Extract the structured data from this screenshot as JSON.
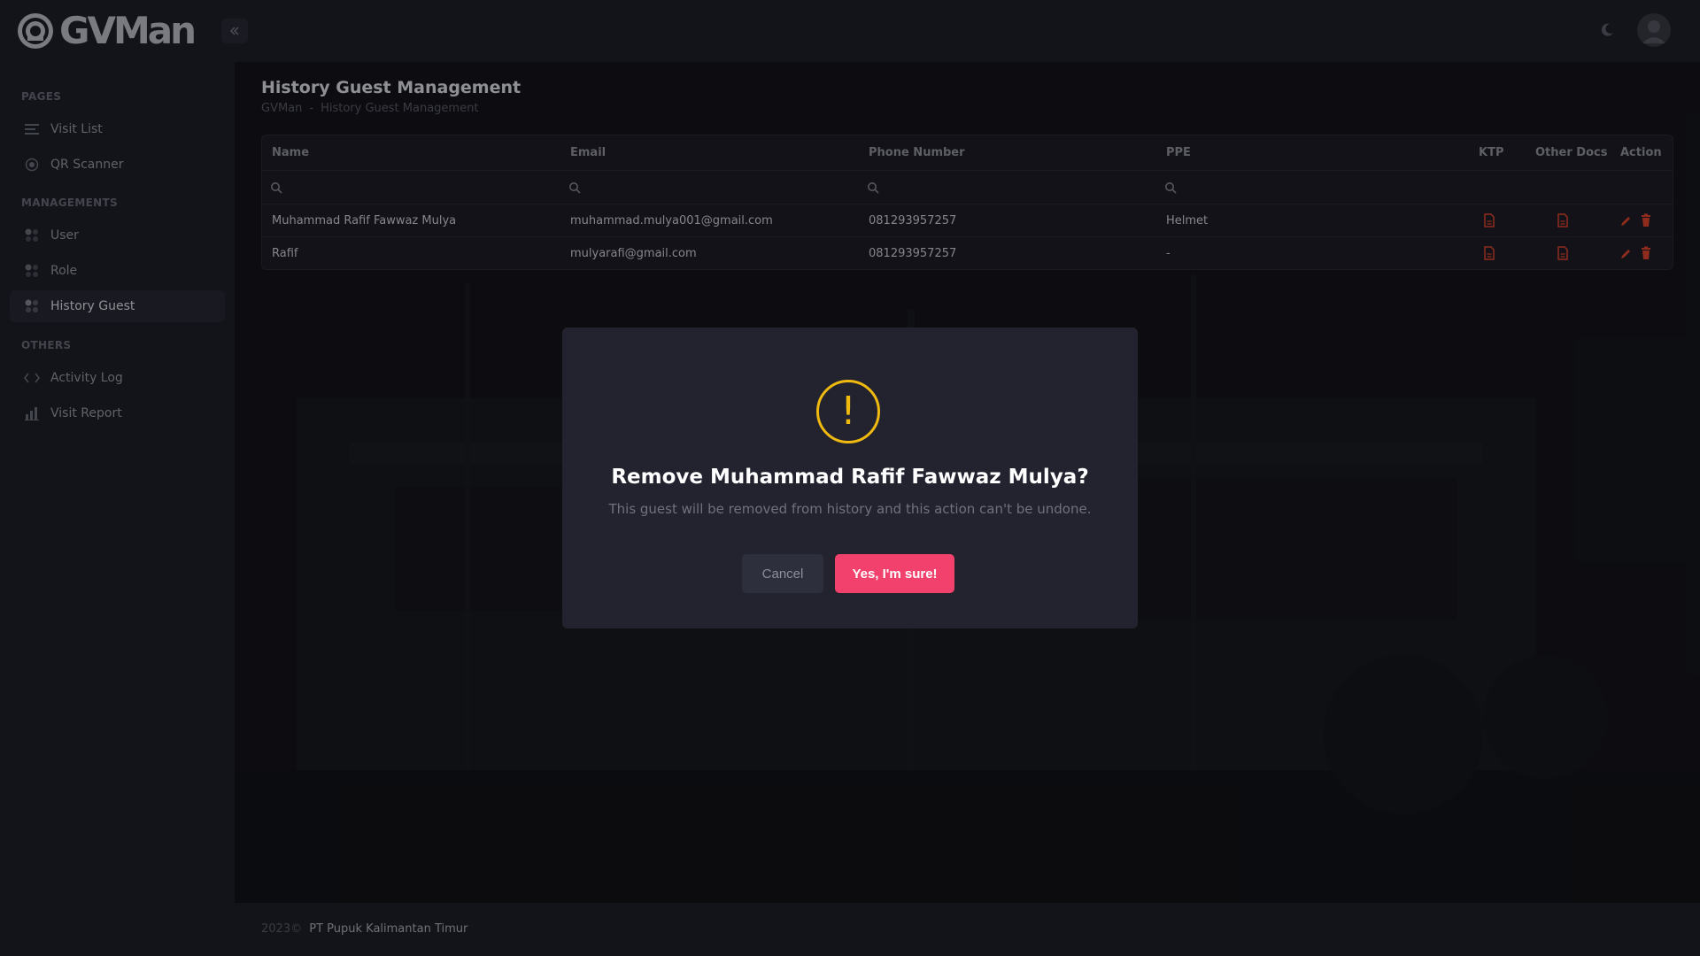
{
  "app": {
    "name": "GVMan"
  },
  "header": {
    "icons": [
      "collapse-icon",
      "moon-icon",
      "avatar-icon"
    ]
  },
  "sidebar": {
    "sections": [
      {
        "label": "PAGES",
        "items": [
          {
            "label": "Visit List",
            "icon": "list-icon"
          },
          {
            "label": "QR Scanner",
            "icon": "target-icon"
          }
        ]
      },
      {
        "label": "MANAGEMENTS",
        "items": [
          {
            "label": "User",
            "icon": "grid-icon"
          },
          {
            "label": "Role",
            "icon": "grid-icon"
          },
          {
            "label": "History Guest",
            "icon": "grid-icon",
            "active": true
          }
        ]
      },
      {
        "label": "OTHERS",
        "items": [
          {
            "label": "Activity Log",
            "icon": "code-icon"
          },
          {
            "label": "Visit Report",
            "icon": "bar-chart-icon"
          }
        ]
      }
    ]
  },
  "page": {
    "title": "History Guest Management",
    "breadcrumb": [
      "GVMan",
      "-",
      "History Guest Management"
    ]
  },
  "table": {
    "columns": [
      "Name",
      "Email",
      "Phone Number",
      "PPE",
      "KTP",
      "Other Docs",
      "Action"
    ],
    "rows": [
      {
        "name": "Muhammad Rafif Fawwaz Mulya",
        "email": "muhammad.mulya001@gmail.com",
        "phone": "081293957257",
        "ppe": "Helmet"
      },
      {
        "name": "Rafif",
        "email": "mulyarafi@gmail.com",
        "phone": "081293957257",
        "ppe": "-"
      }
    ]
  },
  "modal": {
    "icon": "warning-icon",
    "icon_glyph": "!",
    "title": "Remove Muhammad Rafif Fawwaz Mulya?",
    "text": "This guest will be removed from history and this action can't be undone.",
    "cancel_label": "Cancel",
    "confirm_label": "Yes, I'm sure!"
  },
  "footer": {
    "year": "2023©",
    "company": "PT Pupuk Kalimantan Timur"
  },
  "colors": {
    "accent_danger": "#f1416c",
    "warning": "#f0b90f",
    "doc_icon": "#e8472f"
  }
}
